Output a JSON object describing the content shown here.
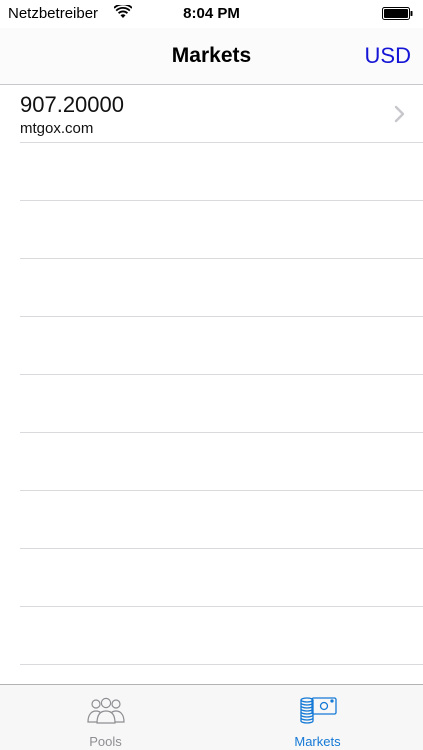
{
  "status_bar": {
    "carrier": "Netzbetreiber",
    "time": "8:04 PM",
    "wifi_icon": "wifi-icon",
    "battery_icon": "battery-icon"
  },
  "nav": {
    "title": "Markets",
    "currency_button": "USD"
  },
  "markets": [
    {
      "price": "907.20000",
      "source": "mtgox.com"
    }
  ],
  "tabs": [
    {
      "label": "Pools",
      "icon": "people-icon",
      "selected": false
    },
    {
      "label": "Markets",
      "icon": "coins-banknote-icon",
      "selected": true
    }
  ],
  "colors": {
    "accent": "#1515d6",
    "tab_selected": "#1479d6",
    "tab_unselected": "#8e8e93",
    "separator": "#d9d9de"
  }
}
